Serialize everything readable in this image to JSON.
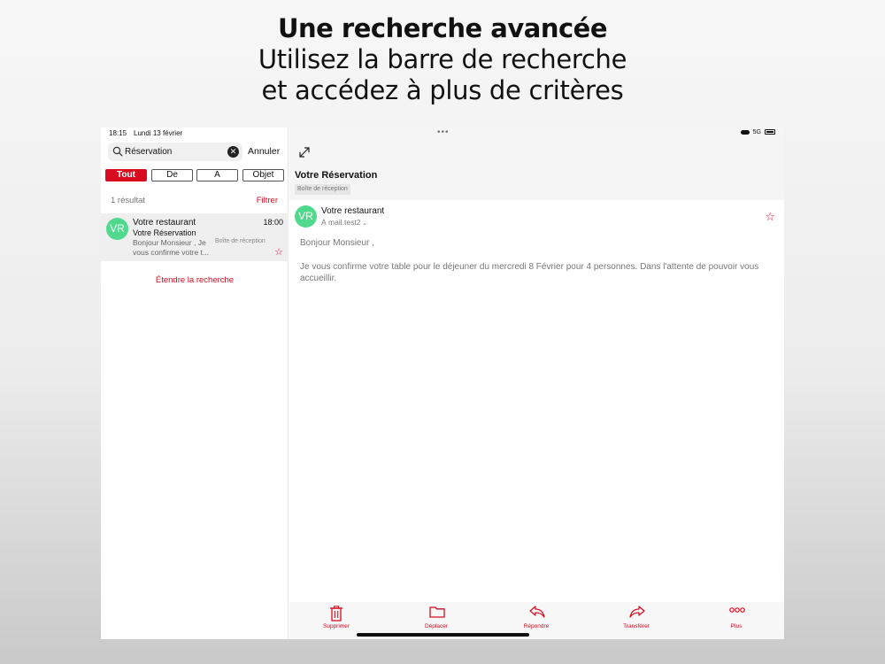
{
  "headline": {
    "title": "Une recherche avancée",
    "line1": "Utilisez la barre de recherche",
    "line2": "et accédez à plus de critères"
  },
  "status": {
    "time": "18:15",
    "date": "Lundi 13 février",
    "network": "5G"
  },
  "search": {
    "value": "Réservation",
    "cancel_label": "Annuler"
  },
  "filters": [
    {
      "label": "Tout",
      "active": true
    },
    {
      "label": "De",
      "active": false
    },
    {
      "label": "A",
      "active": false
    },
    {
      "label": "Objet",
      "active": false
    }
  ],
  "results": {
    "count_label": "1 résultat",
    "filter_label": "Filtrer"
  },
  "mail_list": [
    {
      "initials": "VR",
      "sender": "Votre restaurant",
      "time": "18:00",
      "subject": "Votre Réservation",
      "preview": "Bonjour Monsieur , Je vous confirme votre t...",
      "folder": "Boîte de réception"
    }
  ],
  "extend_search_label": "Étendre la recherche",
  "detail": {
    "title": "Votre Réservation",
    "folder_badge": "Boîte de réception",
    "initials": "VR",
    "sender": "Votre restaurant",
    "to_prefix": "À",
    "to_address": "mail.test2",
    "greeting": "Bonjour Monsieur ,",
    "body": "Je vous confirme votre table pour le déjeuner du mercredi 8 Février pour 4 personnes. Dans l'attente de pouvoir vous accueillir."
  },
  "toolbar": {
    "delete": "Supprimer",
    "move": "Déplacer",
    "reply": "Répondre",
    "forward": "Transférer",
    "more": "Plus"
  },
  "colors": {
    "accent": "#d90b1f",
    "avatar": "#4fd98c"
  }
}
